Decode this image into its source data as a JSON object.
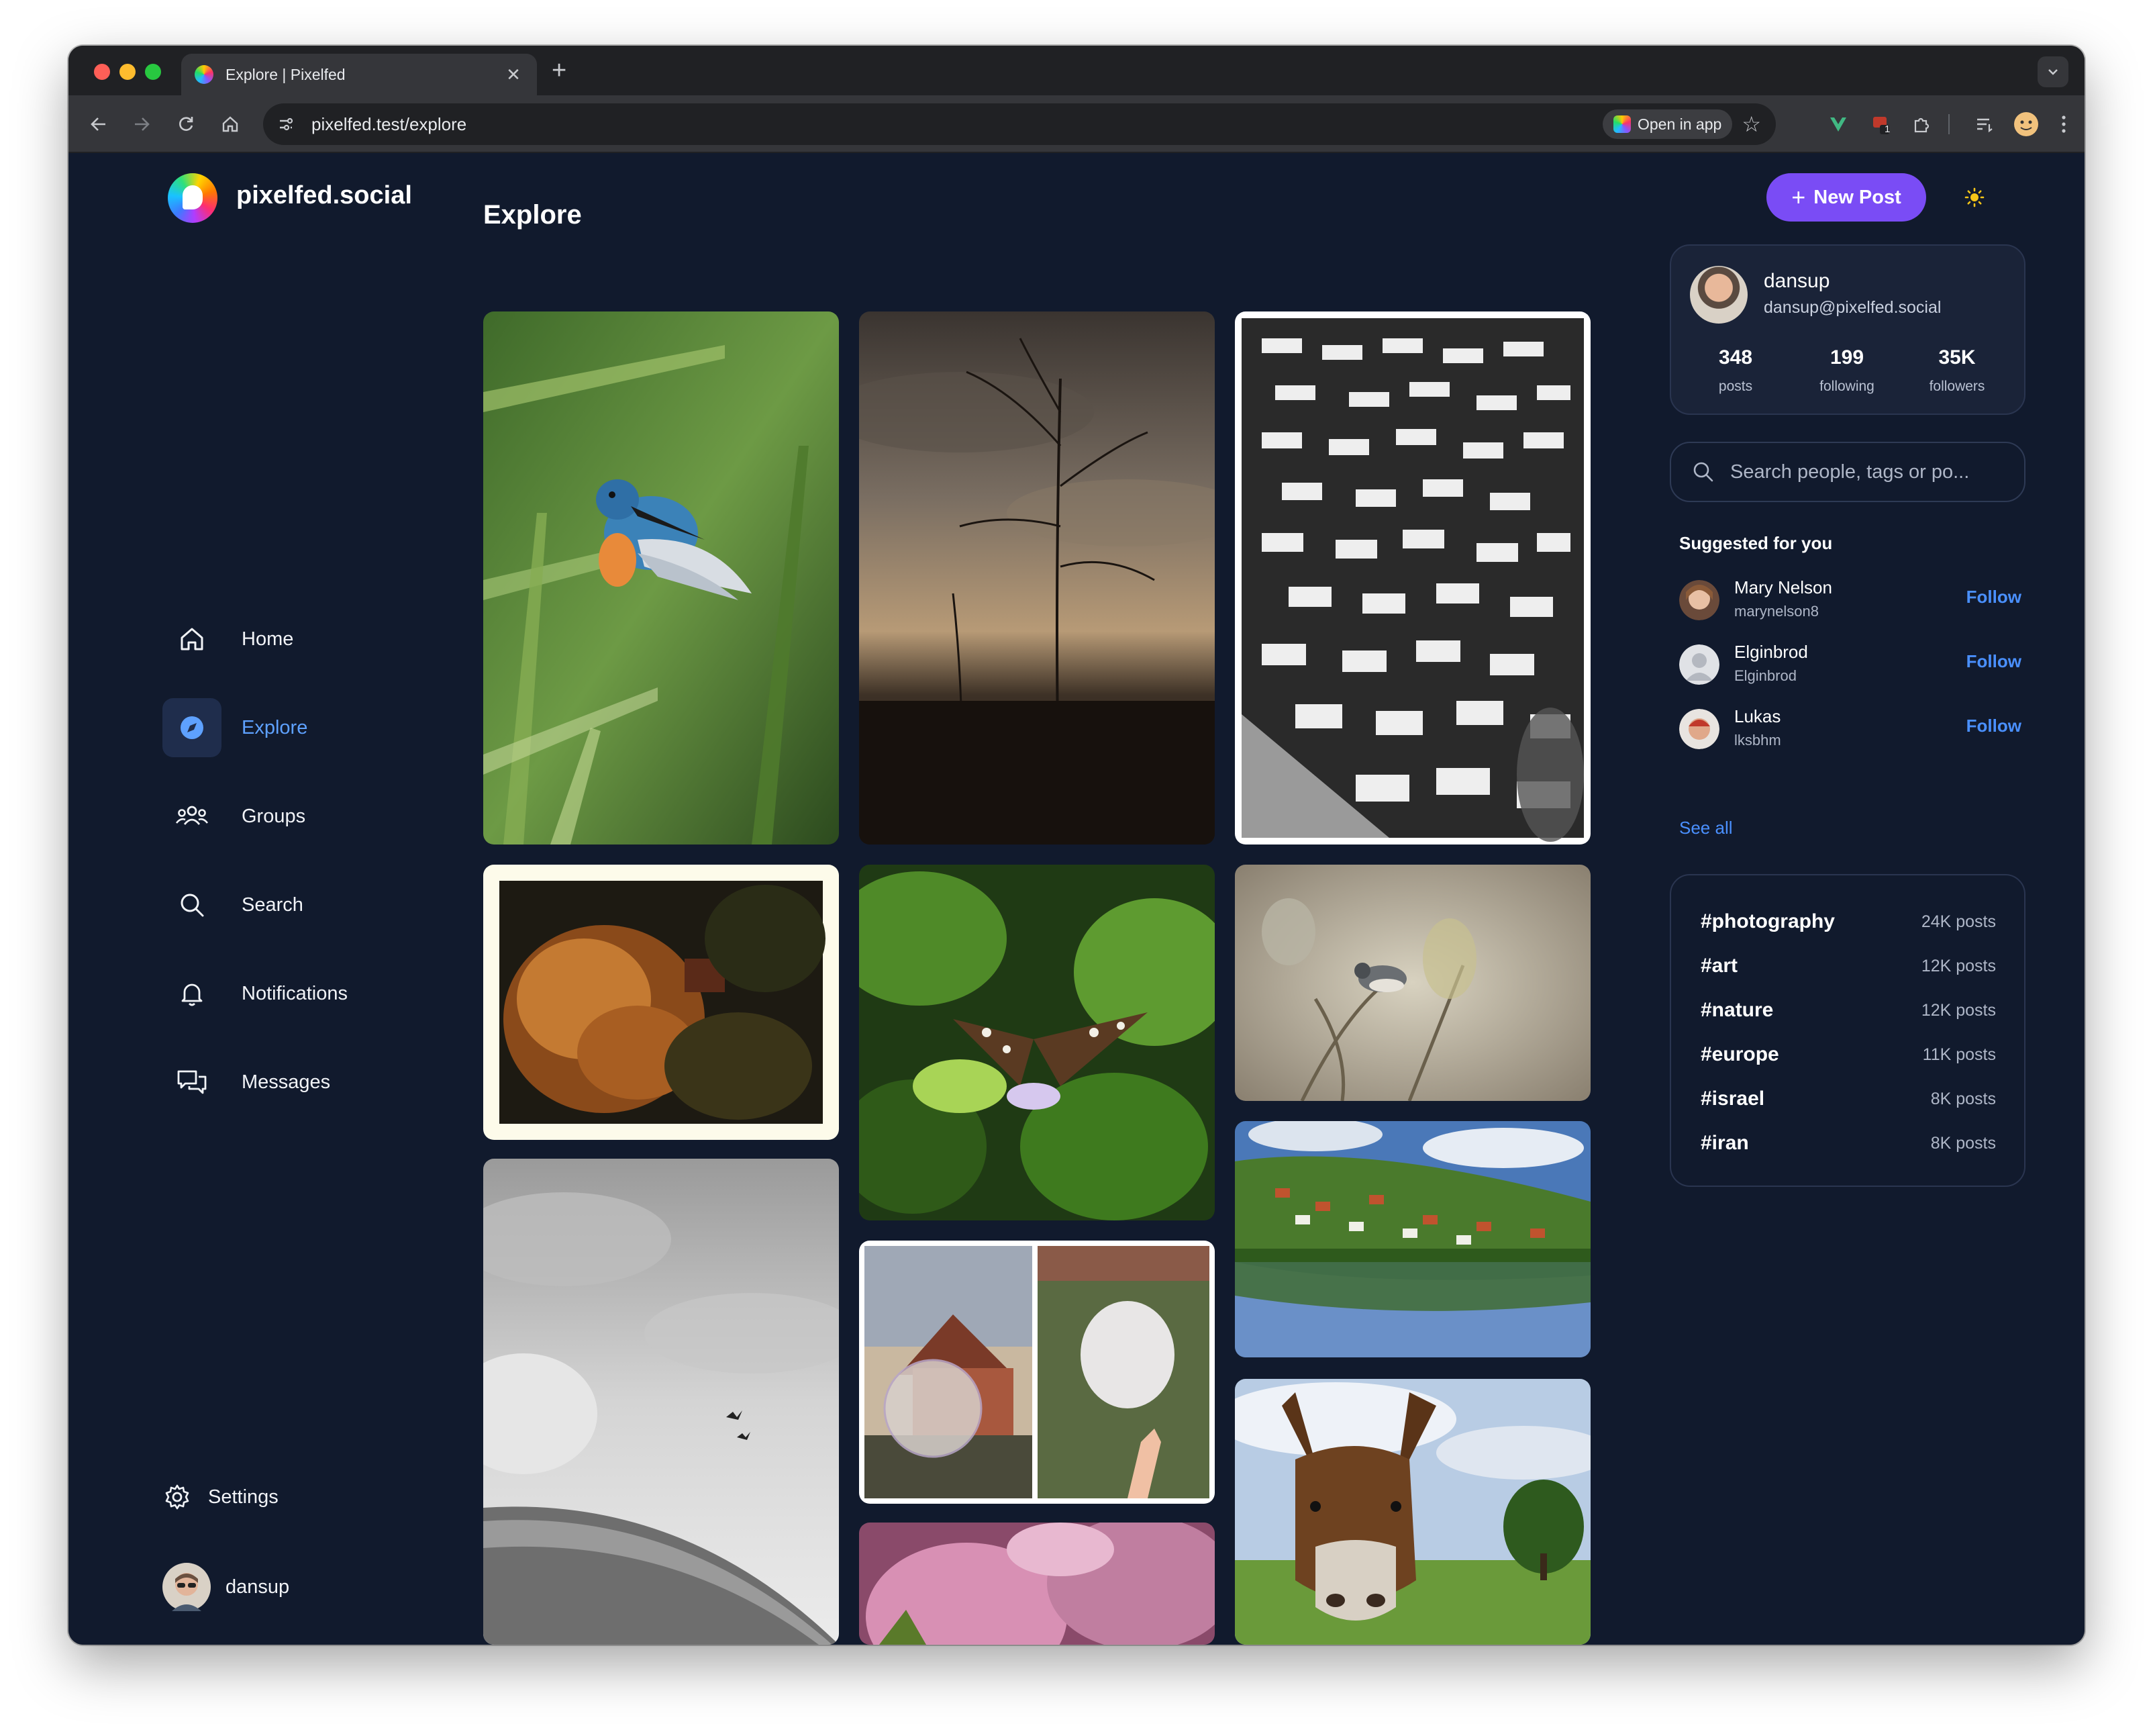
{
  "browser": {
    "tab_title": "Explore | Pixelfed",
    "url": "pixelfed.test/explore",
    "open_in_app_label": "Open in app",
    "extension_badge": "1"
  },
  "app": {
    "brand": "pixelfed.social",
    "new_post_label": "New Post",
    "page_title": "Explore"
  },
  "nav": {
    "items": [
      {
        "label": "Home",
        "icon": "home-icon"
      },
      {
        "label": "Explore",
        "icon": "compass-icon",
        "active": true
      },
      {
        "label": "Groups",
        "icon": "groups-icon"
      },
      {
        "label": "Search",
        "icon": "search-icon"
      },
      {
        "label": "Notifications",
        "icon": "bell-icon"
      },
      {
        "label": "Messages",
        "icon": "chat-icon"
      }
    ],
    "settings_label": "Settings",
    "user_label": "dansup"
  },
  "profile": {
    "name": "dansup",
    "handle": "dansup@pixelfed.social",
    "stats": [
      {
        "value": "348",
        "label": "posts"
      },
      {
        "value": "199",
        "label": "following"
      },
      {
        "value": "35K",
        "label": "followers"
      }
    ]
  },
  "search": {
    "placeholder": "Search people, tags or po..."
  },
  "suggestions": {
    "title": "Suggested for you",
    "follow_label": "Follow",
    "see_all_label": "See all",
    "people": [
      {
        "name": "Mary Nelson",
        "handle": "marynelson8"
      },
      {
        "name": "Elginbrod",
        "handle": "Elginbrod"
      },
      {
        "name": "Lukas",
        "handle": "lksbhm"
      }
    ]
  },
  "trending_tags": [
    {
      "tag": "#photography",
      "count": "24K posts"
    },
    {
      "tag": "#art",
      "count": "12K posts"
    },
    {
      "tag": "#nature",
      "count": "12K posts"
    },
    {
      "tag": "#europe",
      "count": "11K posts"
    },
    {
      "tag": "#israel",
      "count": "8K posts"
    },
    {
      "tag": "#iran",
      "count": "8K posts"
    }
  ],
  "colors": {
    "accent": "#7a4cf5",
    "link": "#4a90ff",
    "active_nav": "#5ea1ff",
    "background": "#111a2d"
  }
}
